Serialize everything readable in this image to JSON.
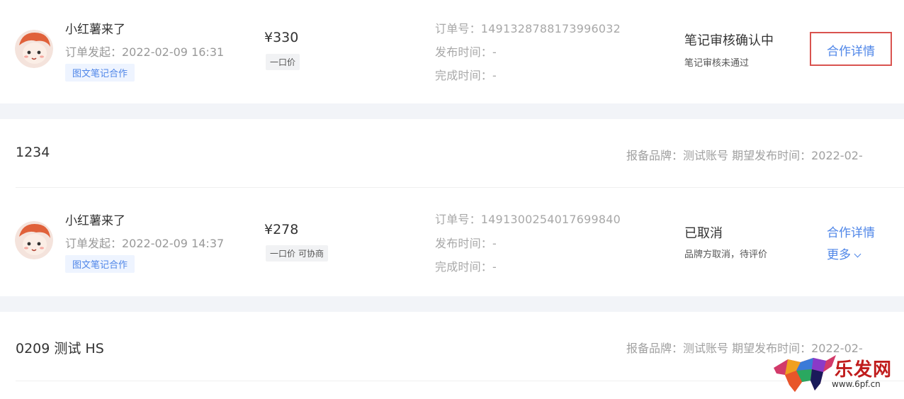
{
  "orders": [
    {
      "user": "小红薯来了",
      "order_start": "订单发起：2022-02-09 16:31",
      "tag": "图文笔记合作",
      "price": "¥330",
      "price_badge": "一口价",
      "price_badge_extra": "",
      "order_no": "订单号：1491328788173996032",
      "publish_time": "发布时间：-",
      "complete_time": "完成时间：-",
      "status": "笔记审核确认中",
      "status_sub": "笔记审核未通过",
      "detail_link": "合作详情",
      "more_link": ""
    },
    {
      "user": "小红薯来了",
      "order_start": "订单发起：2022-02-09 14:37",
      "tag": "图文笔记合作",
      "price": "¥278",
      "price_badge": "一口价",
      "price_badge_extra": "可协商",
      "order_no": "订单号：1491300254017699840",
      "publish_time": "发布时间：-",
      "complete_time": "完成时间：-",
      "status": "已取消",
      "status_sub": "品牌方取消，待评价",
      "detail_link": "合作详情",
      "more_link": "更多"
    }
  ],
  "sections": [
    {
      "title": "1234",
      "meta": "报备品牌：测试账号   期望发布时间：2022-02-"
    },
    {
      "title": "0209 测试 HS",
      "meta": "报备品牌：测试账号   期望发布时间：2022-02-"
    }
  ],
  "watermark": {
    "text": "乐发网",
    "url": "www.6pf.cn"
  },
  "colors": {
    "accent": "#4f86e8",
    "highlight": "#d9534f",
    "band": "#f2f4f8"
  }
}
